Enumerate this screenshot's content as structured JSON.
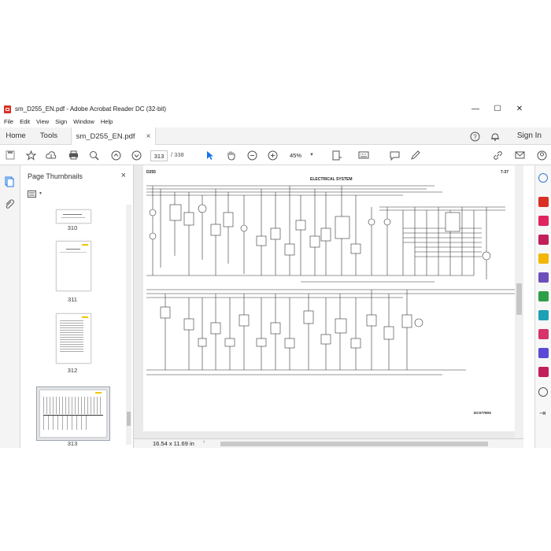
{
  "window": {
    "title": "sm_D255_EN.pdf - Adobe Acrobat Reader DC (32-bit)",
    "minimize_glyph": "—",
    "maximize_glyph": "☐",
    "close_glyph": "✕"
  },
  "menu": [
    "File",
    "Edit",
    "View",
    "Sign",
    "Window",
    "Help"
  ],
  "tabs": {
    "home": "Home",
    "tools": "Tools",
    "document": "sm_D255_EN.pdf",
    "close_glyph": "×",
    "sign_in": "Sign In"
  },
  "toolbar": {
    "current_page": "313",
    "page_separator": "/",
    "total_pages": "338",
    "zoom": "45%"
  },
  "thumbnails": {
    "title": "Page Thumbnails",
    "close_glyph": "×",
    "pages": [
      {
        "number": "310"
      },
      {
        "number": "311"
      },
      {
        "number": "312"
      },
      {
        "number": "313",
        "selected": true
      }
    ]
  },
  "document": {
    "header_left": "D255",
    "header_right": "7-37",
    "heading": "ELECTRICAL SYSTEM",
    "figure_code": "DC07790S"
  },
  "status": {
    "page_size": "16.54 x 11.69 in"
  },
  "colors": {
    "accent": "#1473e6",
    "pdf_red": "#d93025",
    "selected_thumb_border": "#9aa3ad"
  },
  "right_tools": [
    {
      "icon": "search-zoom-icon",
      "color": "#3a7bd5"
    },
    {
      "icon": "export-pdf-icon",
      "color": "#d93025"
    },
    {
      "icon": "create-pdf-icon",
      "color": "#e0245e"
    },
    {
      "icon": "edit-pdf-icon",
      "color": "#c21f5a"
    },
    {
      "icon": "comment-icon",
      "color": "#f2b705"
    },
    {
      "icon": "combine-files-icon",
      "color": "#6b4fbb"
    },
    {
      "icon": "organize-pages-icon",
      "color": "#2e9e47"
    },
    {
      "icon": "scan-icon",
      "color": "#1ba0b5"
    },
    {
      "icon": "fill-sign-icon",
      "color": "#d6336c"
    },
    {
      "icon": "protect-icon",
      "color": "#5b4ad6"
    },
    {
      "icon": "compress-icon",
      "color": "#c21f5a"
    },
    {
      "icon": "more-tools-icon",
      "color": "#555555"
    },
    {
      "icon": "collapse-panel-icon",
      "color": "#555555"
    }
  ]
}
